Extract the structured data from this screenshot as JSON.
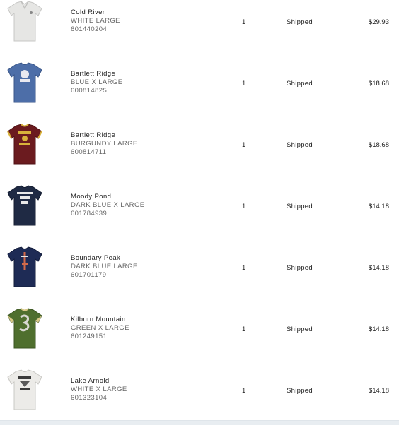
{
  "orders": [
    {
      "name": "Cold River",
      "color_size": "WHITE LARGE",
      "sku": "601440204",
      "qty": "1",
      "status": "Shipped",
      "price": "$29.93",
      "icon": "white-polo-icon",
      "shirt_color": "#e6e6e4"
    },
    {
      "name": "Bartlett Ridge",
      "color_size": "BLUE X LARGE",
      "sku": "600814825",
      "qty": "1",
      "status": "Shipped",
      "price": "$18.68",
      "icon": "blue-graphic-tee-icon",
      "shirt_color": "#4d6ea8"
    },
    {
      "name": "Bartlett Ridge",
      "color_size": "BURGUNDY LARGE",
      "sku": "600814711",
      "qty": "1",
      "status": "Shipped",
      "price": "$18.68",
      "icon": "burgundy-graphic-tee-icon",
      "shirt_color": "#6b1b1f"
    },
    {
      "name": "Moody Pond",
      "color_size": "DARK BLUE X LARGE",
      "sku": "601784939",
      "qty": "1",
      "status": "Shipped",
      "price": "$14.18",
      "icon": "dark-blue-graphic-tee-icon",
      "shirt_color": "#1f2a44"
    },
    {
      "name": "Boundary Peak",
      "color_size": "DARK BLUE LARGE",
      "sku": "601701179",
      "qty": "1",
      "status": "Shipped",
      "price": "$14.18",
      "icon": "dark-blue-graphic-tee-icon",
      "shirt_color": "#1e2b55"
    },
    {
      "name": "Kilburn Mountain",
      "color_size": "GREEN X LARGE",
      "sku": "601249151",
      "qty": "1",
      "status": "Shipped",
      "price": "$14.18",
      "icon": "green-number-tee-icon",
      "shirt_color": "#4f6f2e"
    },
    {
      "name": "Lake Arnold",
      "color_size": "WHITE X LARGE",
      "sku": "601323104",
      "qty": "1",
      "status": "Shipped",
      "price": "$14.18",
      "icon": "white-graphic-tee-icon",
      "shirt_color": "#ecebe8"
    }
  ]
}
